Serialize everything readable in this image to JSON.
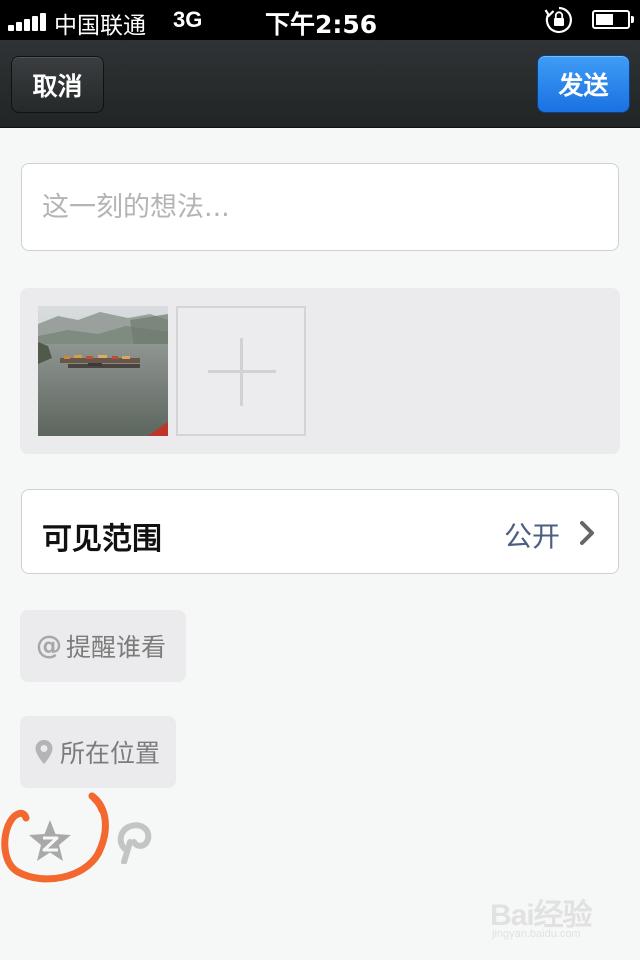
{
  "status_bar": {
    "carrier": "中国联通",
    "network": "3G",
    "time": "下午2:56",
    "battery_level": 0.55
  },
  "nav": {
    "cancel_label": "取消",
    "send_label": "发送"
  },
  "thought": {
    "placeholder": "这一刻的想法..."
  },
  "visibility": {
    "label": "可见范围",
    "value": "公开"
  },
  "mention": {
    "symbol": "@",
    "label": "提醒谁看"
  },
  "location": {
    "label": "所在位置"
  },
  "share_icons": [
    "qzone-icon",
    "pengyou-icon"
  ],
  "colors": {
    "send_button": "#1a71e2",
    "visibility_value": "#4b6080",
    "highlight_circle": "#f2682f"
  },
  "watermark": {
    "text": "Bai经验",
    "sub": "jingyan.baidu.com"
  }
}
